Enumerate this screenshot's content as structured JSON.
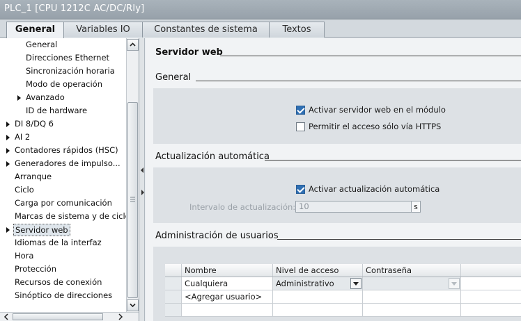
{
  "window": {
    "title": "PLC_1 [CPU 1212C AC/DC/Rly]"
  },
  "tabs": [
    {
      "label": "General"
    },
    {
      "label": "Variables IO"
    },
    {
      "label": "Constantes de sistema"
    },
    {
      "label": "Textos"
    }
  ],
  "nav": {
    "items": [
      {
        "label": "General"
      },
      {
        "label": "Direcciones Ethernet"
      },
      {
        "label": "Sincronización horaria"
      },
      {
        "label": "Modo de operación"
      },
      {
        "label": "Avanzado"
      },
      {
        "label": "ID de hardware"
      },
      {
        "label": "DI 8/DQ 6"
      },
      {
        "label": "AI 2"
      },
      {
        "label": "Contadores rápidos (HSC)"
      },
      {
        "label": "Generadores de impulso..."
      },
      {
        "label": "Arranque"
      },
      {
        "label": "Ciclo"
      },
      {
        "label": "Carga por comunicación"
      },
      {
        "label": "Marcas de sistema y de ciclo"
      },
      {
        "label": "Servidor web"
      },
      {
        "label": "Idiomas de la interfaz"
      },
      {
        "label": "Hora"
      },
      {
        "label": "Protección"
      },
      {
        "label": "Recursos de conexión"
      },
      {
        "label": "Sinóptico de direcciones"
      }
    ]
  },
  "content": {
    "page_title": "Servidor web",
    "general": {
      "title": "General",
      "activate_web_server": {
        "label": "Activar servidor web en el módulo",
        "checked": true
      },
      "https_only": {
        "label": "Permitir el acceso sólo vía HTTPS",
        "checked": false
      }
    },
    "auto_update": {
      "title": "Actualización automática",
      "activate": {
        "label": "Activar actualización automática",
        "checked": true
      },
      "interval_label": "Intervalo de actualización:",
      "interval_value": "10",
      "interval_unit": "s"
    },
    "users": {
      "title": "Administración de usuarios",
      "columns": [
        "Nombre",
        "Nivel de acceso",
        "Contraseña"
      ],
      "rows": [
        {
          "name": "Cualquiera",
          "access": "Administrativo",
          "password": ""
        }
      ],
      "add_user_label": "<Agregar usuario>"
    }
  },
  "colors": {
    "checkbox_on": "#2f6fb3",
    "title_bar": "#a9b3bb"
  }
}
